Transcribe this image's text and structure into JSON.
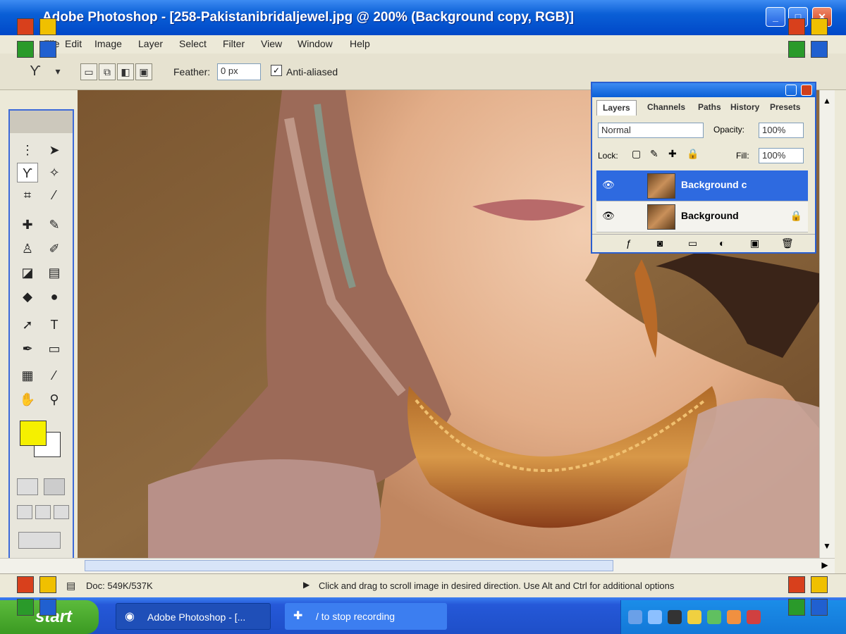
{
  "window": {
    "title": "Adobe Photoshop - [258-Pakistanibridaljewel.jpg @ 200% (Background copy, RGB)]",
    "minimize_glyph": "_",
    "maximize_glyph": "□",
    "close_glyph": "✕"
  },
  "menu": [
    "File",
    "Edit",
    "Image",
    "Layer",
    "Select",
    "Filter",
    "View",
    "Window",
    "Help"
  ],
  "options_bar": {
    "feather_label": "Feather:",
    "feather_value": "0 px",
    "antialiased_label": "Anti-aliased"
  },
  "layers_panel": {
    "tabs": [
      "Layers",
      "Channels",
      "Paths",
      "History",
      "Presets"
    ],
    "blend_mode": "Normal",
    "opacity_label": "Opacity:",
    "opacity_value": "100%",
    "lock_label": "Lock:",
    "fill_label": "Fill:",
    "fill_value": "100%",
    "layers": [
      {
        "name": "Background c",
        "selected": true
      },
      {
        "name": "Background",
        "selected": false
      }
    ]
  },
  "status_bar": {
    "doc_info": "Doc: 549K/537K",
    "hint": "Click and drag to scroll image in desired direction. Use Alt and Ctrl for additional options"
  },
  "taskbar": {
    "start_label": "start",
    "tasks": [
      {
        "label": "Adobe Photoshop - [..."
      },
      {
        "label": "/ to stop recording"
      }
    ]
  },
  "colors": {
    "foreground": "#f5f000",
    "background": "#ffffff",
    "titlebar": "#0a5fd6"
  },
  "icons": [
    "lasso-icon",
    "move-icon",
    "marquee-icon",
    "crop-icon",
    "brush-icon",
    "stamp-icon",
    "eraser-icon",
    "gradient-icon",
    "dodge-icon",
    "path-select-icon",
    "type-icon",
    "pen-icon",
    "shape-icon",
    "notes-icon",
    "eyedropper-icon",
    "hand-icon",
    "zoom-icon"
  ]
}
